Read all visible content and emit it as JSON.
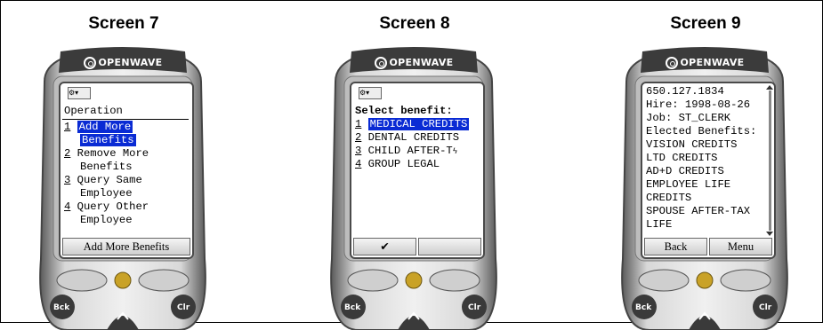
{
  "screens": [
    {
      "title": "Screen 7",
      "brand": "OPENWAVE",
      "header": "Operation",
      "items": [
        {
          "num": "1",
          "line1": "Add More",
          "line2": "Benefits",
          "selected": true
        },
        {
          "num": "2",
          "line1": "Remove More",
          "line2": "Benefits",
          "selected": false
        },
        {
          "num": "3",
          "line1": "Query Same",
          "line2": "Employee",
          "selected": false
        },
        {
          "num": "4",
          "line1": "Query Other",
          "line2": "Employee",
          "selected": false
        }
      ],
      "softkeys": [
        "Add More Benefits"
      ]
    },
    {
      "title": "Screen 8",
      "brand": "OPENWAVE",
      "header": "Select benefit:",
      "items": [
        {
          "num": "1",
          "label": "MEDICAL CREDITS",
          "selected": true
        },
        {
          "num": "2",
          "label": "DENTAL CREDITS",
          "selected": false
        },
        {
          "num": "3",
          "label": "CHILD AFTER-T",
          "selected": false
        },
        {
          "num": "4",
          "label": "GROUP LEGAL",
          "selected": false
        }
      ],
      "softkeys": [
        "✔",
        ""
      ]
    },
    {
      "title": "Screen 9",
      "brand": "OPENWAVE",
      "lines": [
        "650.127.1834",
        "Hire: 1998-08-26",
        "Job: ST_CLERK",
        "Elected Benefits:",
        "VISION CREDITS",
        "LTD CREDITS",
        "AD+D CREDITS",
        "EMPLOYEE LIFE",
        "CREDITS",
        "SPOUSE AFTER-TAX",
        "LIFE"
      ],
      "softkeys": [
        "Back",
        "Menu"
      ]
    }
  ],
  "keys": {
    "back": "Bck",
    "clear": "Clr"
  }
}
